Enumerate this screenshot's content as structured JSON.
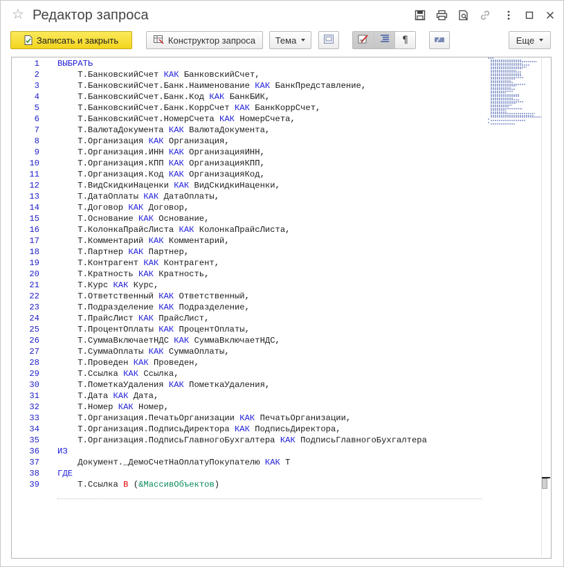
{
  "window": {
    "title": "Редактор запроса"
  },
  "toolbar": {
    "save_close_label": "Записать и закрыть",
    "query_builder_label": "Конструктор запроса",
    "theme_label": "Тема",
    "more_label": "Еще"
  },
  "colors": {
    "primary_button": "#f5d92a",
    "keyword": "#1b1bd9",
    "operator": "#e00000",
    "line_number": "#2020c8",
    "parameter": "#0b8a5a"
  },
  "editor": {
    "lines": [
      [
        {
          "t": "ВЫБРАТЬ",
          "c": "kw"
        }
      ],
      [
        {
          "t": "    Т.БанковскийСчет "
        },
        {
          "t": "КАК",
          "c": "kw"
        },
        {
          "t": " БанковскийСчет,"
        }
      ],
      [
        {
          "t": "    Т.БанковскийСчет.Банк.Наименование "
        },
        {
          "t": "КАК",
          "c": "kw"
        },
        {
          "t": " БанкПредставление,"
        }
      ],
      [
        {
          "t": "    Т.БанковскийСчет.Банк.Код "
        },
        {
          "t": "КАК",
          "c": "kw"
        },
        {
          "t": " БанкБИК,"
        }
      ],
      [
        {
          "t": "    Т.БанковскийСчет.Банк.КоррСчет "
        },
        {
          "t": "КАК",
          "c": "kw"
        },
        {
          "t": " БанкКоррСчет,"
        }
      ],
      [
        {
          "t": "    Т.БанковскийСчет.НомерСчета "
        },
        {
          "t": "КАК",
          "c": "kw"
        },
        {
          "t": " НомерСчета,"
        }
      ],
      [
        {
          "t": "    Т.ВалютаДокумента "
        },
        {
          "t": "КАК",
          "c": "kw"
        },
        {
          "t": " ВалютаДокумента,"
        }
      ],
      [
        {
          "t": "    Т.Организация "
        },
        {
          "t": "КАК",
          "c": "kw"
        },
        {
          "t": " Организация,"
        }
      ],
      [
        {
          "t": "    Т.Организация.ИНН "
        },
        {
          "t": "КАК",
          "c": "kw"
        },
        {
          "t": " ОрганизацияИНН,"
        }
      ],
      [
        {
          "t": "    Т.Организация.КПП "
        },
        {
          "t": "КАК",
          "c": "kw"
        },
        {
          "t": " ОрганизацияКПП,"
        }
      ],
      [
        {
          "t": "    Т.Организация.Код "
        },
        {
          "t": "КАК",
          "c": "kw"
        },
        {
          "t": " ОрганизацияКод,"
        }
      ],
      [
        {
          "t": "    Т.ВидСкидкиНаценки "
        },
        {
          "t": "КАК",
          "c": "kw"
        },
        {
          "t": " ВидСкидкиНаценки,"
        }
      ],
      [
        {
          "t": "    Т.ДатаОплаты "
        },
        {
          "t": "КАК",
          "c": "kw"
        },
        {
          "t": " ДатаОплаты,"
        }
      ],
      [
        {
          "t": "    Т.Договор "
        },
        {
          "t": "КАК",
          "c": "kw"
        },
        {
          "t": " Договор,"
        }
      ],
      [
        {
          "t": "    Т.Основание "
        },
        {
          "t": "КАК",
          "c": "kw"
        },
        {
          "t": " Основание,"
        }
      ],
      [
        {
          "t": "    Т.КолонкаПрайсЛиста "
        },
        {
          "t": "КАК",
          "c": "kw"
        },
        {
          "t": " КолонкаПрайсЛиста,"
        }
      ],
      [
        {
          "t": "    Т.Комментарий "
        },
        {
          "t": "КАК",
          "c": "kw"
        },
        {
          "t": " Комментарий,"
        }
      ],
      [
        {
          "t": "    Т.Партнер "
        },
        {
          "t": "КАК",
          "c": "kw"
        },
        {
          "t": " Партнер,"
        }
      ],
      [
        {
          "t": "    Т.Контрагент "
        },
        {
          "t": "КАК",
          "c": "kw"
        },
        {
          "t": " Контрагент,"
        }
      ],
      [
        {
          "t": "    Т.Кратность "
        },
        {
          "t": "КАК",
          "c": "kw"
        },
        {
          "t": " Кратность,"
        }
      ],
      [
        {
          "t": "    Т.Курс "
        },
        {
          "t": "КАК",
          "c": "kw"
        },
        {
          "t": " Курс,"
        }
      ],
      [
        {
          "t": "    Т.Ответственный "
        },
        {
          "t": "КАК",
          "c": "kw"
        },
        {
          "t": " Ответственный,"
        }
      ],
      [
        {
          "t": "    Т.Подразделение "
        },
        {
          "t": "КАК",
          "c": "kw"
        },
        {
          "t": " Подразделение,"
        }
      ],
      [
        {
          "t": "    Т.ПрайсЛист "
        },
        {
          "t": "КАК",
          "c": "kw"
        },
        {
          "t": " ПрайсЛист,"
        }
      ],
      [
        {
          "t": "    Т.ПроцентОплаты "
        },
        {
          "t": "КАК",
          "c": "kw"
        },
        {
          "t": " ПроцентОплаты,"
        }
      ],
      [
        {
          "t": "    Т.СуммаВключаетНДС "
        },
        {
          "t": "КАК",
          "c": "kw"
        },
        {
          "t": " СуммаВключаетНДС,"
        }
      ],
      [
        {
          "t": "    Т.СуммаОплаты "
        },
        {
          "t": "КАК",
          "c": "kw"
        },
        {
          "t": " СуммаОплаты,"
        }
      ],
      [
        {
          "t": "    Т.Проведен "
        },
        {
          "t": "КАК",
          "c": "kw"
        },
        {
          "t": " Проведен,"
        }
      ],
      [
        {
          "t": "    Т.Ссылка "
        },
        {
          "t": "КАК",
          "c": "kw"
        },
        {
          "t": " Ссылка,"
        }
      ],
      [
        {
          "t": "    Т.ПометкаУдаления "
        },
        {
          "t": "КАК",
          "c": "kw"
        },
        {
          "t": " ПометкаУдаления,"
        }
      ],
      [
        {
          "t": "    Т.Дата "
        },
        {
          "t": "КАК",
          "c": "kw"
        },
        {
          "t": " Дата,"
        }
      ],
      [
        {
          "t": "    Т.Номер "
        },
        {
          "t": "КАК",
          "c": "kw"
        },
        {
          "t": " Номер,"
        }
      ],
      [
        {
          "t": "    Т.Организация.ПечатьОрганизации "
        },
        {
          "t": "КАК",
          "c": "kw"
        },
        {
          "t": " ПечатьОрганизации,"
        }
      ],
      [
        {
          "t": "    Т.Организация.ПодписьДиректора "
        },
        {
          "t": "КАК",
          "c": "kw"
        },
        {
          "t": " ПодписьДиректора,"
        }
      ],
      [
        {
          "t": "    Т.Организация.ПодписьГлавногоБухгалтера "
        },
        {
          "t": "КАК",
          "c": "kw"
        },
        {
          "t": " ПодписьГлавногоБухгалтера"
        }
      ],
      [
        {
          "t": "ИЗ",
          "c": "kw"
        }
      ],
      [
        {
          "t": "    Документ._ДемоСчетНаОплатуПокупателю "
        },
        {
          "t": "КАК",
          "c": "kw"
        },
        {
          "t": " Т"
        }
      ],
      [
        {
          "t": "ГДЕ",
          "c": "kw"
        }
      ],
      [
        {
          "t": "    Т.Ссылка "
        },
        {
          "t": "В",
          "c": "kw-red"
        },
        {
          "t": " "
        },
        {
          "t": "(",
          "c": "par"
        },
        {
          "t": "&МассивОбъектов",
          "c": "param"
        },
        {
          "t": ")",
          "c": "par"
        }
      ]
    ]
  }
}
